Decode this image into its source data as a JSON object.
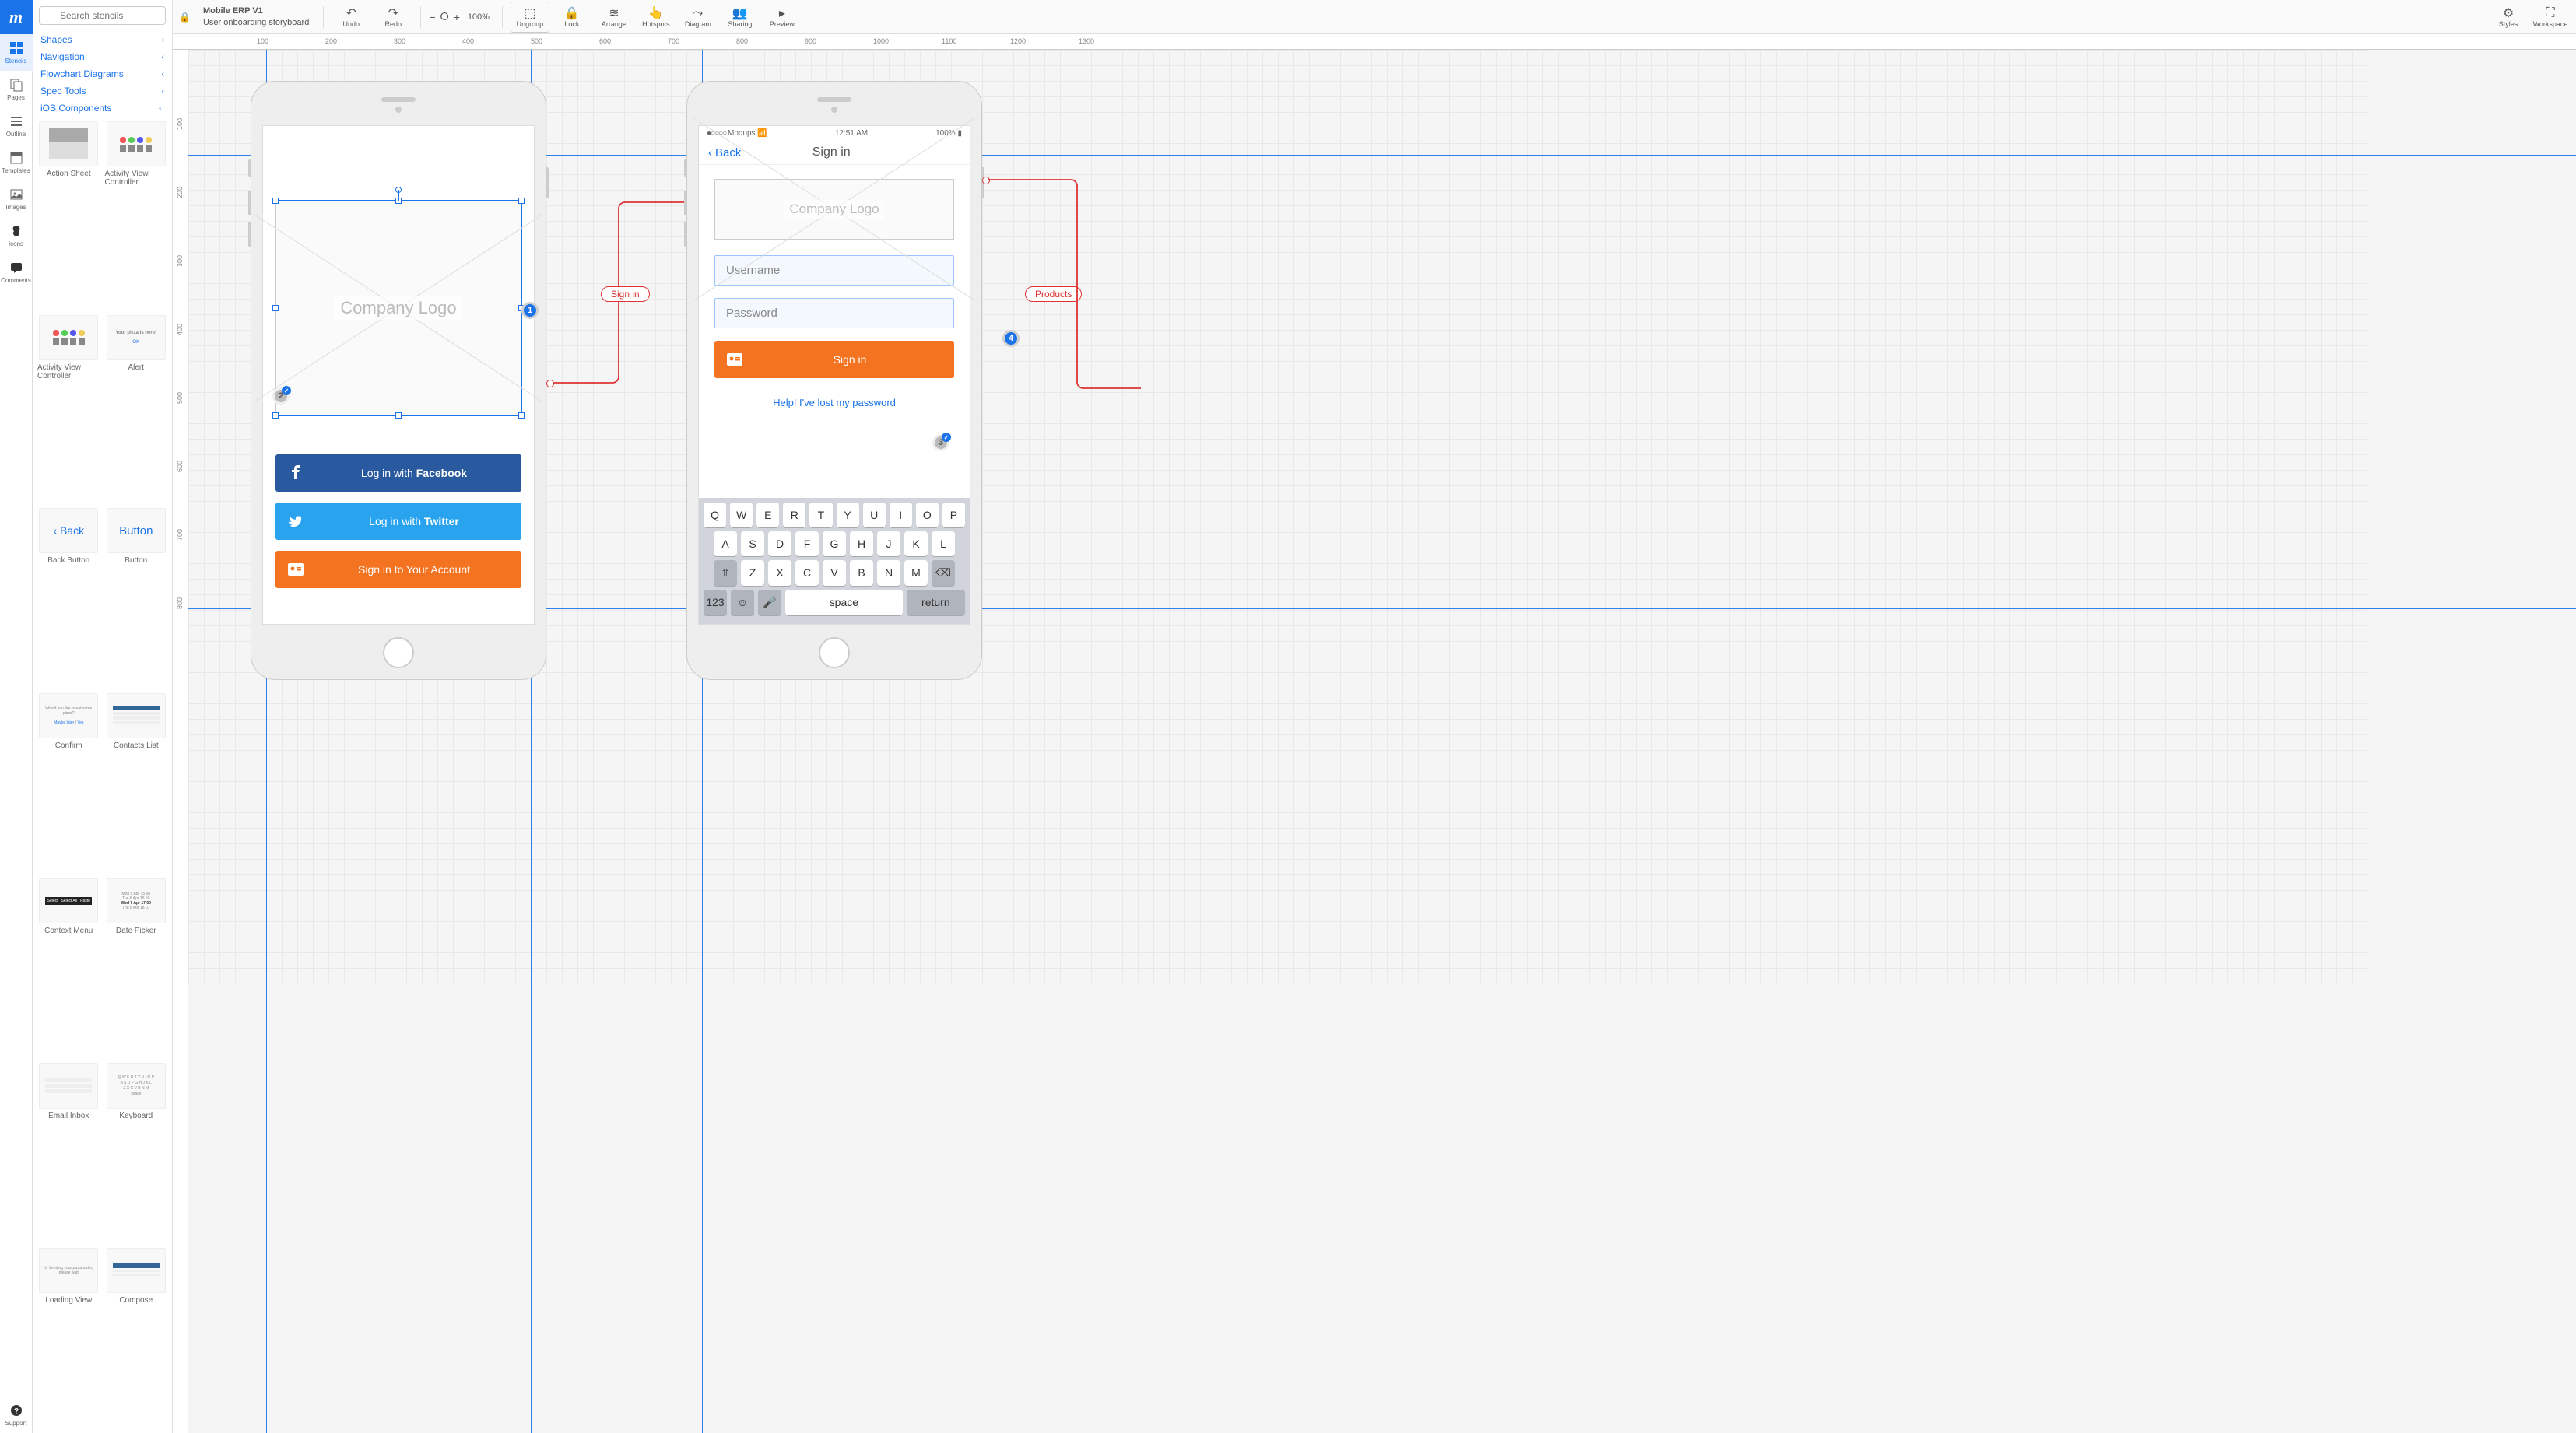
{
  "app": {
    "logo": "m"
  },
  "document": {
    "title": "Mobile ERP V1",
    "subtitle": "User onboarding storyboard",
    "locked": true
  },
  "toolbar": {
    "undo": "Undo",
    "redo": "Redo",
    "zoom": "100%",
    "ungroup": "Ungroup",
    "lock": "Lock",
    "arrange": "Arrange",
    "hotspots": "Hotspots",
    "diagram": "Diagram",
    "sharing": "Sharing",
    "preview": "Preview",
    "styles": "Styles",
    "workspace": "Workspace"
  },
  "rail": {
    "stencils": "Stencils",
    "pages": "Pages",
    "outline": "Outline",
    "templates": "Templates",
    "images": "Images",
    "icons": "Icons",
    "comments": "Comments",
    "support": "Support"
  },
  "search": {
    "placeholder": "Search stencils"
  },
  "categories": [
    {
      "label": "Shapes",
      "expanded": false
    },
    {
      "label": "Navigation",
      "expanded": false
    },
    {
      "label": "Flowchart Diagrams",
      "expanded": false
    },
    {
      "label": "Spec Tools",
      "expanded": false
    },
    {
      "label": "iOS Components",
      "expanded": true
    }
  ],
  "stencils": [
    "Action Sheet",
    "Activity View Controller",
    "Activity View Controller",
    "Alert",
    "Back Button",
    "Button",
    "Confirm",
    "Contacts List",
    "Context Menu",
    "Date Picker",
    "Email Inbox",
    "Keyboard",
    "Loading View",
    "Compose"
  ],
  "stencil_thumbs": {
    "back": "Back",
    "button": "Button",
    "alert_title": "Your pizza is here!",
    "alert_ok": "OK",
    "confirm_q": "Would you like to eat some pizza?",
    "confirm_maybe": "Maybe later",
    "confirm_yes": "Yes"
  },
  "ruler_h": [
    "100",
    "200",
    "300",
    "400",
    "500",
    "600",
    "700",
    "800",
    "900",
    "1000",
    "1100",
    "1200",
    "1300"
  ],
  "ruler_v": [
    "100",
    "200",
    "300",
    "400",
    "500",
    "600",
    "700",
    "800"
  ],
  "screen1": {
    "logo": "Company Logo",
    "fb": {
      "prefix": "Log in with ",
      "bold": "Facebook"
    },
    "tw": {
      "prefix": "Log in with ",
      "bold": "Twitter"
    },
    "signin": "Sign in to Your Account"
  },
  "screen2": {
    "status": {
      "carrier": "Moqups",
      "time": "12:51 AM",
      "battery": "100%"
    },
    "nav": {
      "back": "Back",
      "title": "Sign in"
    },
    "logo": "Company Logo",
    "username_ph": "Username",
    "password_ph": "Password",
    "signin_btn": "Sign in",
    "help": "Help! I've lost my password",
    "keyboard": {
      "row1": [
        "Q",
        "W",
        "E",
        "R",
        "T",
        "Y",
        "U",
        "I",
        "O",
        "P"
      ],
      "row2": [
        "A",
        "S",
        "D",
        "F",
        "G",
        "H",
        "J",
        "K",
        "L"
      ],
      "row3": [
        "⇧",
        "Z",
        "X",
        "C",
        "V",
        "B",
        "N",
        "M",
        "⌫"
      ],
      "row4": [
        "123",
        "☺",
        "🎤",
        "space",
        "return"
      ]
    }
  },
  "hotspots": {
    "signin": "Sign in",
    "products": "Products"
  },
  "badges": {
    "b1": "1",
    "b2": "2",
    "b3": "3",
    "b4": "4"
  }
}
